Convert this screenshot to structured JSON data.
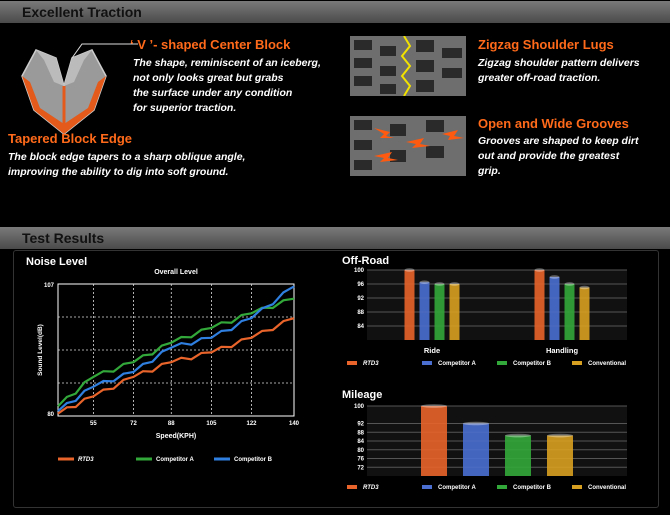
{
  "sections": {
    "traction_title": "Excellent Traction",
    "test_title": "Test Results"
  },
  "features": {
    "v_center": {
      "title": "‘ V ’- shaped Center Block",
      "lines": [
        "The shape, reminiscent of an iceberg,",
        "not only looks great but grabs",
        "the surface under any condition",
        "for superior traction."
      ]
    },
    "tapered": {
      "title": "Tapered Block Edge",
      "lines": [
        "The block edge tapers to a sharp oblique angle,",
        "improving the ability to dig into soft ground."
      ]
    },
    "zigzag": {
      "title": "Zigzag Shoulder Lugs",
      "lines": [
        "Zigzag shoulder pattern delivers",
        "greater off-road traction."
      ]
    },
    "grooves": {
      "title": "Open and Wide Grooves",
      "lines": [
        "Grooves are shaped to keep dirt",
        "out and provide the greatest",
        "grip."
      ]
    }
  },
  "icons": {
    "tread_profile": "tire-tread-profile-icon",
    "zigzag_photo": "zigzag-tread-photo-icon",
    "groove_photo": "groove-tread-photo-icon"
  },
  "colors": {
    "accent": "#ff6a1a",
    "rtd": "#e8642a",
    "competitor_a": "#4a6fd0",
    "competitor_b": "#33a83a",
    "conventional": "#d8a020"
  },
  "chart_data": [
    {
      "type": "line",
      "title": "Noise Level",
      "subtitle": "Overall Level",
      "xlabel": "Speed(KPH)",
      "ylabel": "Sound Level(dB)",
      "x": [
        40,
        55,
        72,
        88,
        105,
        122,
        140
      ],
      "x_ticks": [
        "55",
        "72",
        "88",
        "105",
        "122",
        "140"
      ],
      "xlim": [
        40,
        140
      ],
      "ylim": [
        80,
        107
      ],
      "y_ticks": [
        "80",
        "107"
      ],
      "grid": true,
      "series": [
        {
          "name": "RTD3",
          "color": "#e8642a",
          "values": [
            80.5,
            84,
            88,
            91,
            93,
            96,
            100
          ]
        },
        {
          "name": "Competitor A",
          "color": "#33a83a",
          "values": [
            82,
            88,
            91,
            95,
            98,
            101,
            104
          ]
        },
        {
          "name": "Competitor B",
          "color": "#2f7fe0",
          "values": [
            81,
            86,
            89,
            94,
            96,
            100,
            106.5
          ]
        }
      ]
    },
    {
      "type": "bar",
      "title": "Off-Road",
      "categories": [
        "Ride",
        "Handling"
      ],
      "ylim": [
        80,
        100
      ],
      "y_ticks": [
        "84",
        "88",
        "92",
        "96",
        "100"
      ],
      "series": [
        {
          "name": "RTD3",
          "values": [
            100,
            100
          ]
        },
        {
          "name": "Competitor A",
          "values": [
            96.5,
            98
          ]
        },
        {
          "name": "Competitor B",
          "values": [
            96,
            96
          ]
        },
        {
          "name": "Conventional",
          "values": [
            96,
            95
          ]
        }
      ]
    },
    {
      "type": "bar",
      "title": "Mileage",
      "categories": [
        ""
      ],
      "ylim": [
        68,
        100
      ],
      "y_ticks": [
        "72",
        "76",
        "80",
        "84",
        "88",
        "92",
        "100"
      ],
      "series": [
        {
          "name": "RTD3",
          "values": [
            100
          ]
        },
        {
          "name": "Competitor A",
          "values": [
            92
          ]
        },
        {
          "name": "Competitor B",
          "values": [
            86.5
          ]
        },
        {
          "name": "Conventional",
          "values": [
            86.5
          ]
        }
      ]
    }
  ]
}
